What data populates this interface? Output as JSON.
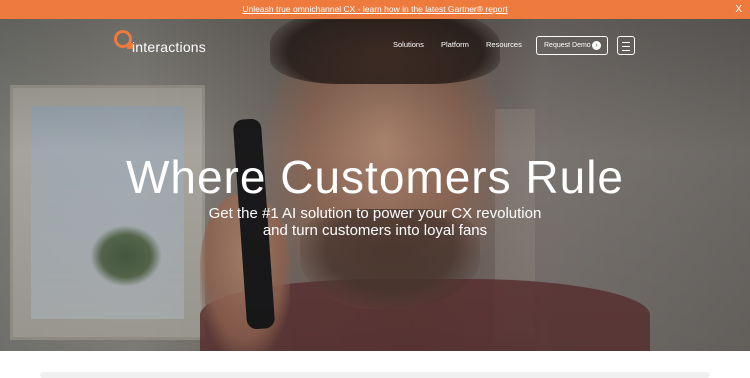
{
  "announcement": {
    "text": "Unleash true omnichannel CX - learn how in the latest Gartner® report",
    "close_label": "X"
  },
  "brand": {
    "name": "interactions",
    "accent": "#ef7a3e"
  },
  "nav": {
    "items": [
      {
        "label": "Solutions"
      },
      {
        "label": "Platform"
      },
      {
        "label": "Resources"
      }
    ],
    "demo_label": "Request Demo",
    "demo_icon": "arrow-right-icon",
    "menu_icon": "hamburger-menu-icon"
  },
  "hero": {
    "headline": "Where Customers Rule",
    "subheadline": "Get the #1 AI solution to power your CX revolution and turn customers into loyal fans"
  }
}
